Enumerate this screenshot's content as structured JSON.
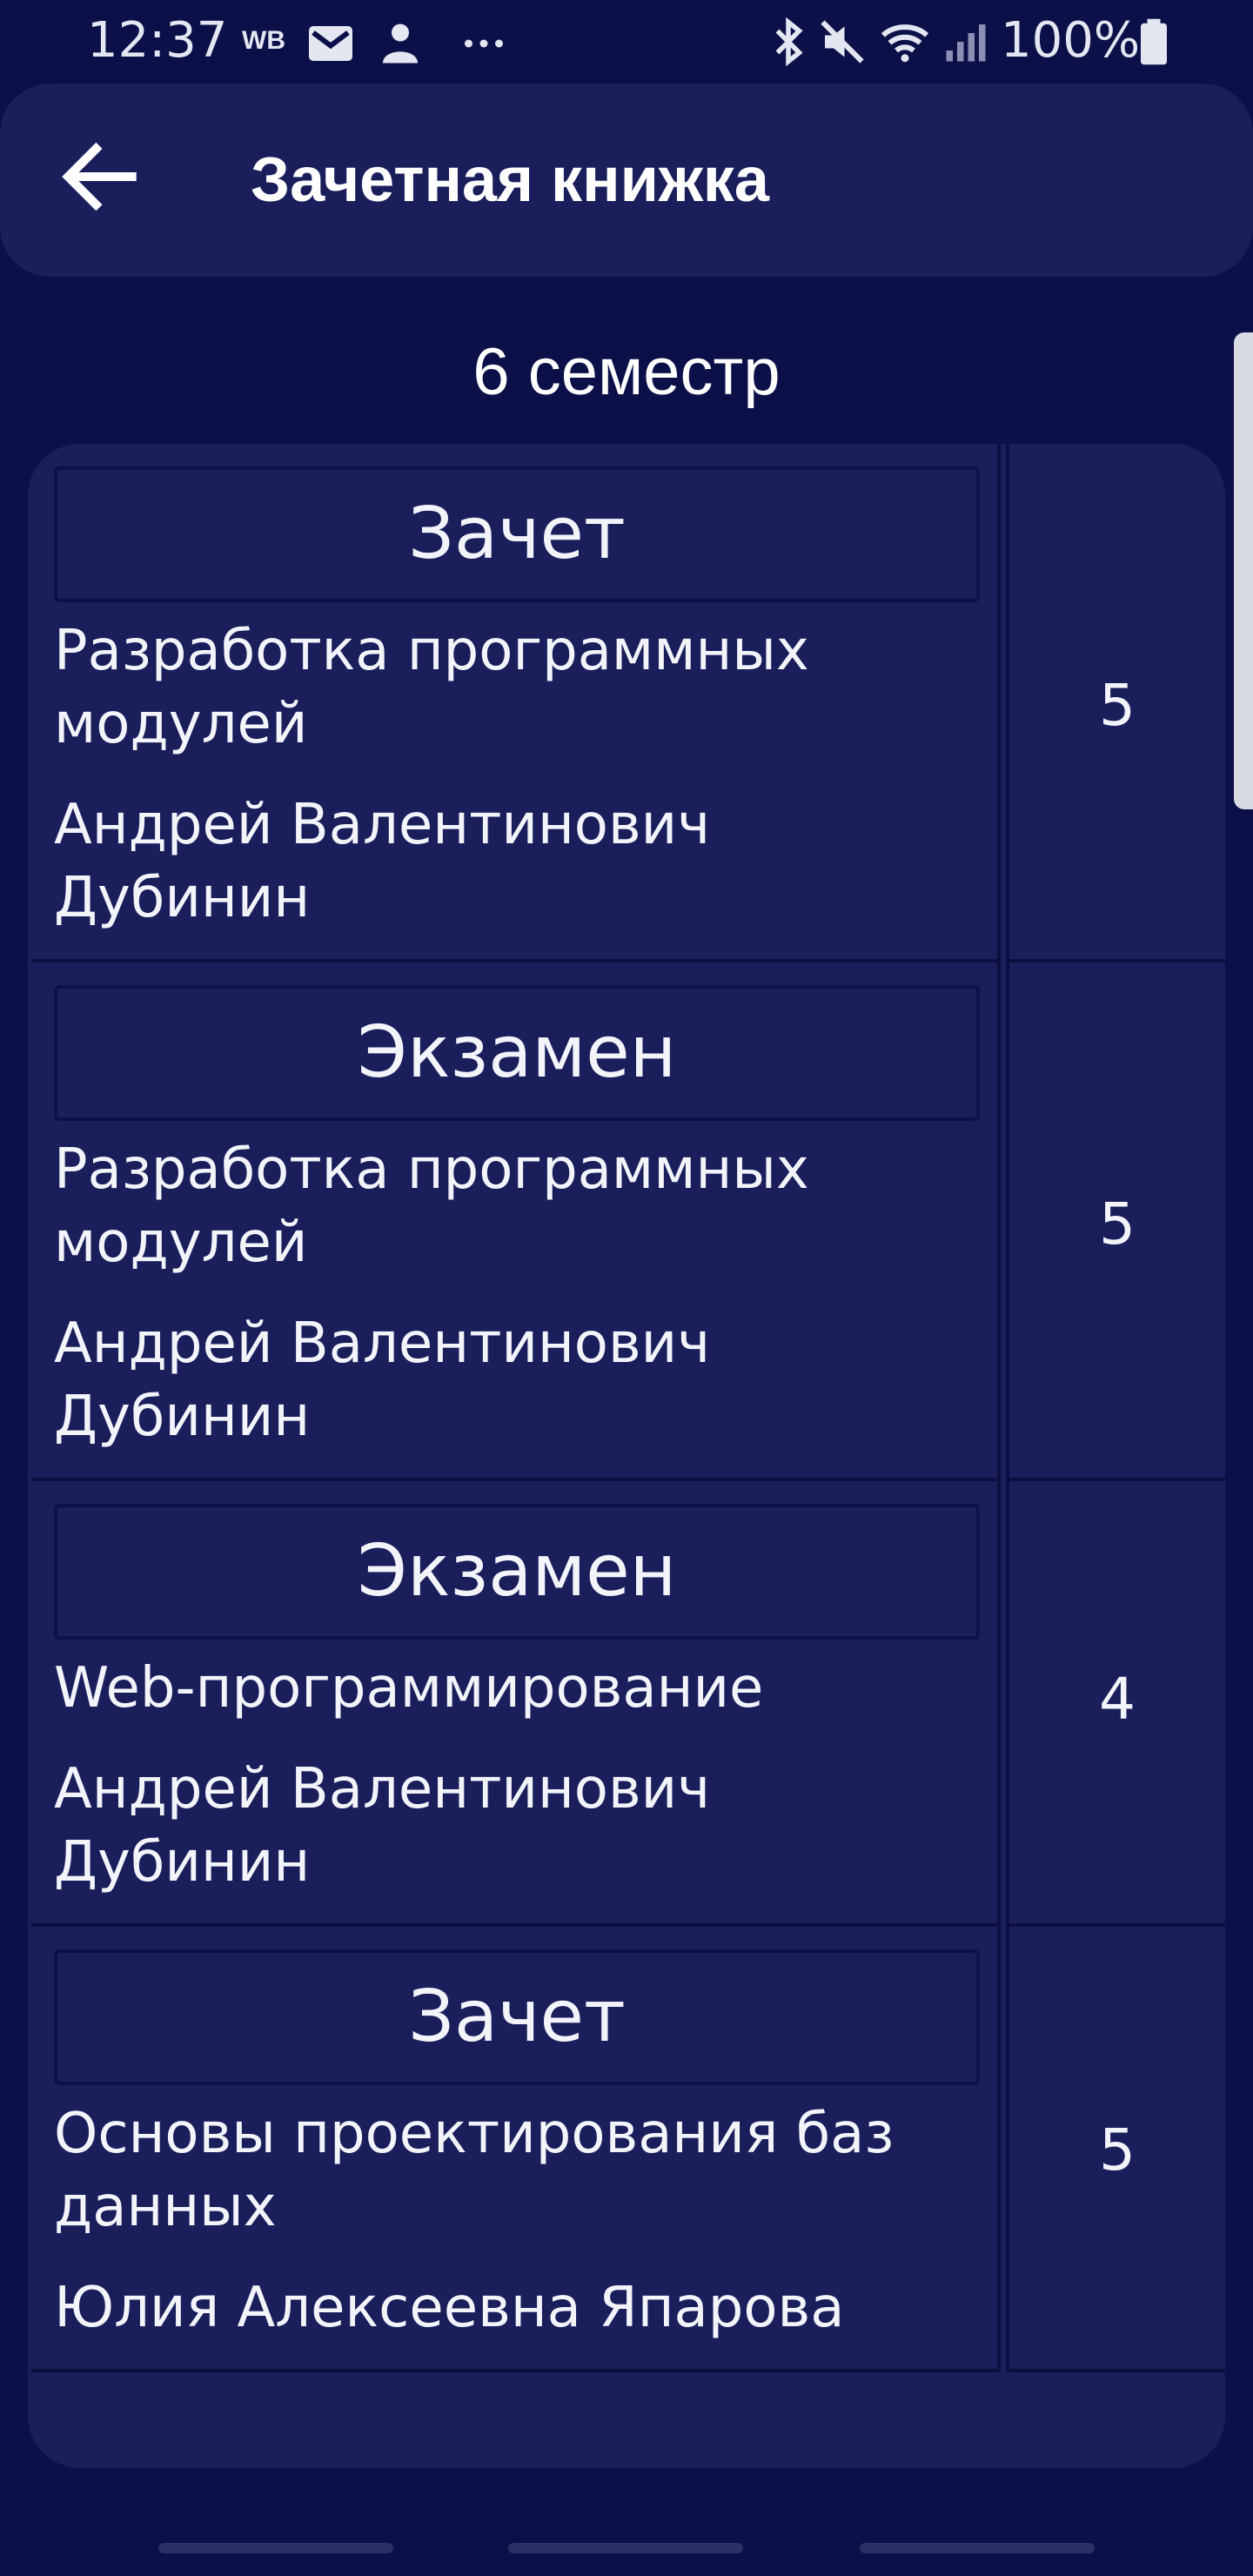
{
  "status_bar": {
    "time": "12:37",
    "carrier_badge": "WB",
    "left_icons": [
      "mail-icon",
      "notification-icon",
      "more-dots-icon"
    ],
    "right_icons": [
      "bluetooth-icon",
      "mute-icon",
      "wifi-icon",
      "signal-icon",
      "battery-icon"
    ],
    "battery_percent": "100%"
  },
  "app_bar": {
    "title": "Зачетная книжка",
    "back_icon": "arrow-left-icon"
  },
  "semester_title": "6 семестр",
  "records": [
    {
      "type": "Зачет",
      "subject": [
        "Разработка программных",
        "модулей"
      ],
      "teacher": [
        "Андрей Валентинович",
        "Дубинин"
      ],
      "grade": "5"
    },
    {
      "type": "Экзамен",
      "subject": [
        "Разработка программных",
        "модулей"
      ],
      "teacher": [
        "Андрей Валентинович",
        "Дубинин"
      ],
      "grade": "5"
    },
    {
      "type": "Экзамен",
      "subject": [
        "Web-программирование"
      ],
      "teacher": [
        "Андрей Валентинович",
        "Дубинин"
      ],
      "grade": "4"
    },
    {
      "type": "Зачет",
      "subject": [
        "Основы проектирования баз",
        "данных"
      ],
      "teacher": [
        "Юлия Алексеевна Япарова"
      ],
      "grade": "5"
    }
  ],
  "colors": {
    "background": "#0c1048",
    "card": "#1a1f5c",
    "text": "#f3f4fa"
  }
}
